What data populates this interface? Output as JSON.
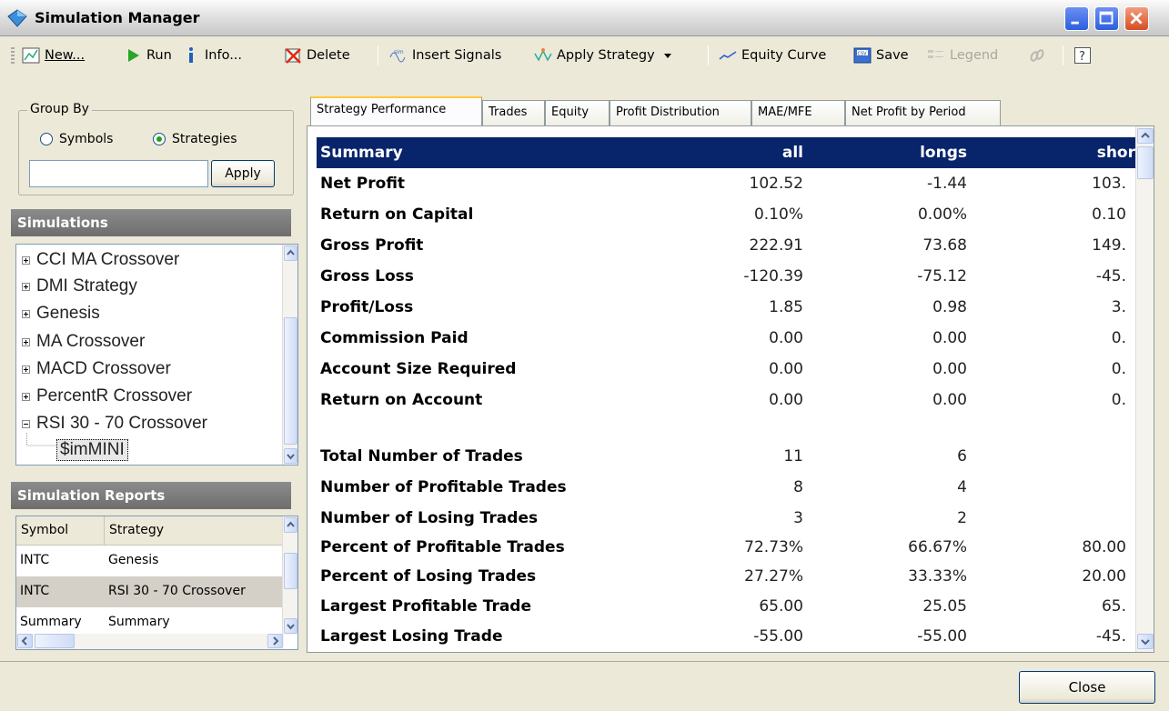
{
  "window": {
    "title": "Simulation Manager"
  },
  "toolbar": {
    "new": "New...",
    "run": "Run",
    "info": "Info...",
    "delete": "Delete",
    "insert_signals": "Insert Signals",
    "apply_strategy": "Apply Strategy",
    "equity_curve": "Equity Curve",
    "save": "Save",
    "legend": "Legend"
  },
  "group_by": {
    "label": "Group By",
    "symbols": "Symbols",
    "strategies": "Strategies",
    "selected": "Strategies",
    "filter_value": "",
    "apply": "Apply"
  },
  "simulations": {
    "header": "Simulations",
    "items": [
      {
        "label": "CCI MA Crossover",
        "expanded": false
      },
      {
        "label": "DMI Strategy",
        "expanded": false
      },
      {
        "label": "Genesis",
        "expanded": false
      },
      {
        "label": "MA Crossover",
        "expanded": false
      },
      {
        "label": "MACD Crossover",
        "expanded": false
      },
      {
        "label": "PercentR Crossover",
        "expanded": false
      },
      {
        "label": "RSI 30 - 70 Crossover",
        "expanded": true
      }
    ],
    "child": "$imMINI"
  },
  "reports": {
    "header": "Simulation Reports",
    "columns": [
      "Symbol",
      "Strategy"
    ],
    "rows": [
      [
        "INTC",
        "Genesis"
      ],
      [
        "INTC",
        "RSI 30 - 70 Crossover"
      ],
      [
        "Summary",
        "Summary"
      ]
    ]
  },
  "tabs": [
    "Strategy Performance",
    "Trades",
    "Equity",
    "Profit Distribution",
    "MAE/MFE",
    "Net Profit by Period"
  ],
  "grid": {
    "header": [
      "Summary",
      "all",
      "longs",
      "shor"
    ],
    "rows": [
      [
        "Net Profit",
        "102.52",
        "-1.44",
        "103."
      ],
      [
        "Return on Capital",
        "0.10%",
        "0.00%",
        "0.10"
      ],
      [
        "Gross Profit",
        "222.91",
        "73.68",
        "149."
      ],
      [
        "Gross Loss",
        "-120.39",
        "-75.12",
        "-45."
      ],
      [
        "Profit/Loss",
        "1.85",
        "0.98",
        "3."
      ],
      [
        "Commission Paid",
        "0.00",
        "0.00",
        "0."
      ],
      [
        "Account Size Required",
        "0.00",
        "0.00",
        "0."
      ],
      [
        "Return on Account",
        "0.00",
        "0.00",
        "0."
      ],
      [
        "",
        "",
        "",
        ""
      ],
      [
        "Total Number of Trades",
        "11",
        "6",
        ""
      ],
      [
        "Number of Profitable Trades",
        "8",
        "4",
        ""
      ],
      [
        "Number of Losing Trades",
        "3",
        "2",
        ""
      ],
      [
        "Percent of Profitable Trades",
        "72.73%",
        "66.67%",
        "80.00"
      ],
      [
        "Percent of Losing Trades",
        "27.27%",
        "33.33%",
        "20.00"
      ],
      [
        "Largest Profitable Trade",
        "65.00",
        "25.05",
        "65."
      ],
      [
        "Largest Losing Trade",
        "-55.00",
        "-55.00",
        "-45."
      ]
    ]
  },
  "footer": {
    "close": "Close"
  },
  "colors": {
    "grid_header_bg": "#08246b",
    "section_header_bg": "#7a7a7a",
    "active_tab_accent": "#ffc83c"
  }
}
